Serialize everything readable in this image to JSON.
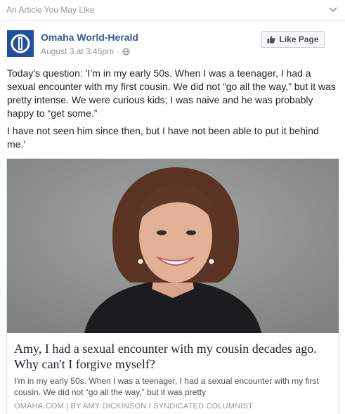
{
  "header": {
    "label": "An Article You May Like"
  },
  "post": {
    "page_name": "Omaha World-Herald",
    "timestamp": "August 3 at 3:45pm",
    "separator": "·",
    "like_button": "Like Page",
    "paragraphs": [
      "Today's question: 'I’m in my early 50s. When I was a teenager, I had a sexual encounter with my first cousin. We did not “go all the way,” but it was pretty intense. We were curious kids; I was naive and he was probably happy to “get some.”",
      "I have not seen him since then, but I have not been able to put it behind me.'"
    ]
  },
  "card": {
    "title": "Amy, I had a sexual encounter with my cousin decades ago. Why can't I forgive myself?",
    "description": "I'm in my early 50s. When I was a teenager, I had a sexual encounter with my first cousin. We did not “go all the way,” but it was pretty",
    "source": "OMAHA.COM | BY AMY DICKINSON / SYNDICATED COLUMNIST"
  },
  "icons": {
    "logo": "omaha-world-herald-logo",
    "globe": "globe-icon",
    "thumb": "thumbs-up-icon",
    "chevron": "chevron-down-icon"
  },
  "colors": {
    "link": "#365899",
    "text": "#1d2129",
    "muted": "#90949c",
    "logo_bg": "#1f4f9e"
  }
}
